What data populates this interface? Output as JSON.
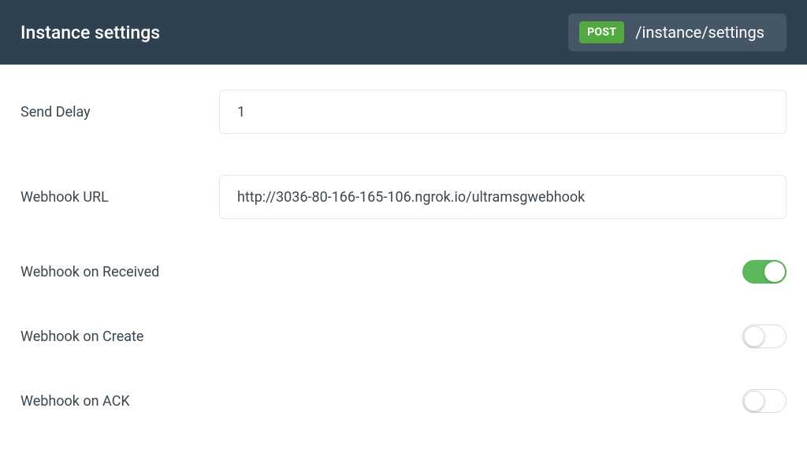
{
  "header": {
    "title": "Instance settings",
    "method": "POST",
    "endpoint": "/instance/settings"
  },
  "form": {
    "send_delay": {
      "label": "Send Delay",
      "value": "1"
    },
    "webhook_url": {
      "label": "Webhook URL",
      "value": "http://3036-80-166-165-106.ngrok.io/ultramsgwebhook"
    },
    "webhook_received": {
      "label": "Webhook on Received",
      "on": true
    },
    "webhook_create": {
      "label": "Webhook on Create",
      "on": false
    },
    "webhook_ack": {
      "label": "Webhook on ACK",
      "on": false
    }
  }
}
